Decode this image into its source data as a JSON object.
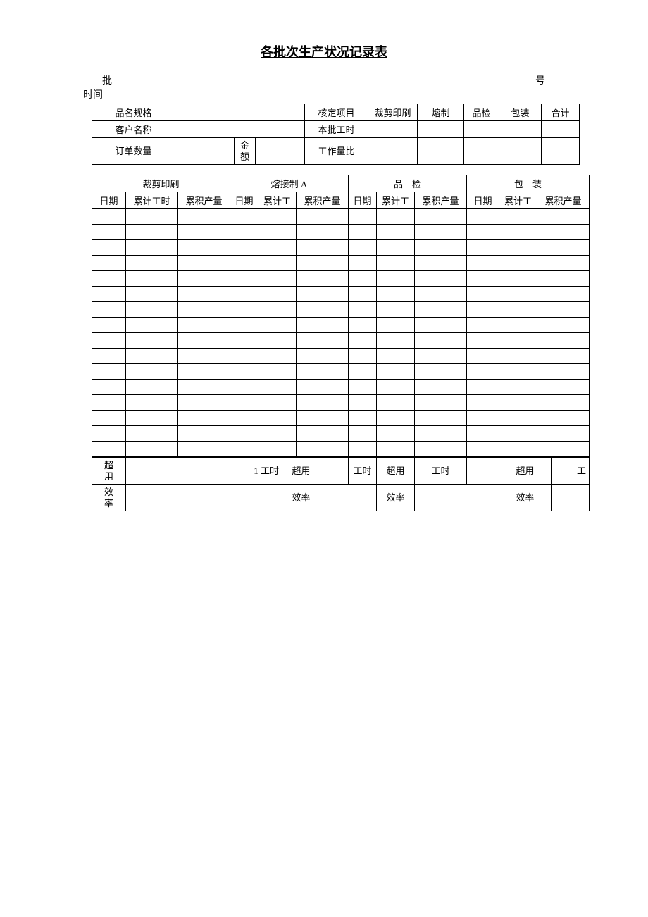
{
  "title": "各批次生产状况记录表",
  "meta": {
    "batch_label": "批",
    "number_label": "号",
    "time_label": "时间"
  },
  "hdr": {
    "spec": "品名规格",
    "approved_item": "核定项目",
    "cut_print": "裁剪印刷",
    "melt": "熔制",
    "qc": "品检",
    "pack": "包装",
    "total": "合计",
    "customer": "客户名称",
    "batch_hours": "本批工时",
    "order_qty": "订单数量",
    "amount": "金\n额",
    "amount1": "金",
    "amount2": "额",
    "work_ratio": "工作量比"
  },
  "grp": {
    "cut_print": "裁剪印刷",
    "weld_a": "熔接制 A",
    "qc": "品　检",
    "pack": "包　装"
  },
  "col": {
    "date": "日期",
    "acc_hours": "累计工时",
    "acc_hours_s": "累计工",
    "acc_qty": "累积产量"
  },
  "foot": {
    "overuse": "超用",
    "overuse1": "超",
    "overuse2": "用",
    "hours_1": "1 工时",
    "hours": "工时",
    "wh": "工",
    "eff": "效率",
    "eff1": "效",
    "eff2": "率"
  }
}
